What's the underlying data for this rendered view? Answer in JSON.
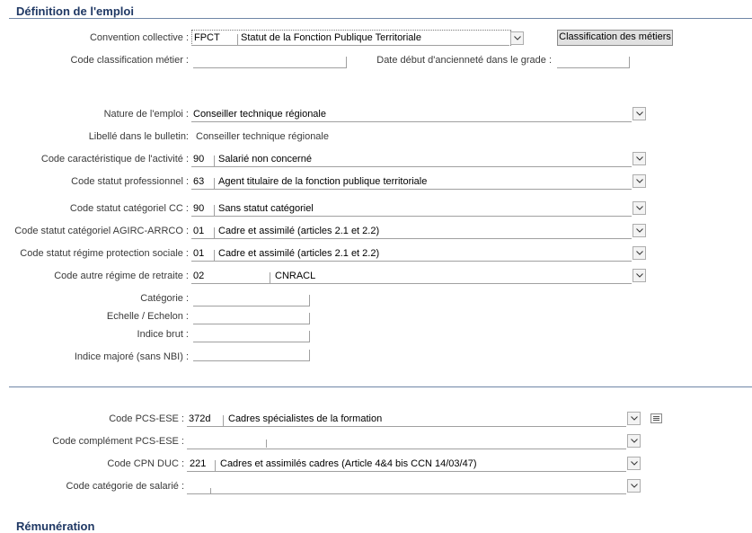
{
  "section": {
    "title": "Définition de l'emploi",
    "next_title": "Rémunération"
  },
  "convention": {
    "label": "Convention collective :",
    "code": "FPCT",
    "value": "Statut de la Fonction Publique Territoriale",
    "button": "Classification des métiers"
  },
  "classification": {
    "label": "Code classification métier :",
    "value": "",
    "date_label": "Date début d'ancienneté dans le grade :",
    "date_value": ""
  },
  "fields": {
    "nature": {
      "label": "Nature de l'emploi :",
      "value": "Conseiller technique régionale"
    },
    "libelle": {
      "label": "Libellé dans le bulletin:",
      "value": "Conseiller technique régionale"
    },
    "activite": {
      "label": "Code caractéristique de l'activité :",
      "code": "90",
      "value": "Salarié non concerné"
    },
    "statut_pro": {
      "label": "Code statut professionnel :",
      "code": "63",
      "value": "Agent titulaire de la fonction publique territoriale"
    },
    "statut_cc": {
      "label": "Code statut catégoriel CC :",
      "code": "90",
      "value": "Sans statut catégoriel"
    },
    "statut_agirc": {
      "label": "Code statut catégoriel AGIRC-ARRCO :",
      "code": "01",
      "value": "Cadre et assimilé (articles 2.1 et 2.2)"
    },
    "regime_protection": {
      "label": "Code statut régime protection sociale :",
      "code": "01",
      "value": "Cadre et assimilé (articles 2.1 et 2.2)"
    },
    "autre_regime": {
      "label": "Code autre régime de retraite :",
      "code": "02",
      "value": "CNRACL"
    },
    "categorie": {
      "label": "Catégorie :",
      "value": ""
    },
    "echelle": {
      "label": "Echelle / Echelon :",
      "value": ""
    },
    "indice_brut": {
      "label": "Indice brut :",
      "value": ""
    },
    "indice_majore": {
      "label": "Indice majoré (sans NBI) :",
      "value": ""
    }
  },
  "pcs": {
    "pcs_ese": {
      "label": "Code PCS-ESE :",
      "code": "372d",
      "value": "Cadres spécialistes de la formation"
    },
    "complement": {
      "label": "Code complément PCS-ESE :",
      "code": "",
      "value": ""
    },
    "cpn_duc": {
      "label": "Code CPN DUC :",
      "code": "221",
      "value": "Cadres et assimilés cadres (Article 4&4 bis CCN 14/03/47)"
    },
    "categorie_salarie": {
      "label": "Code catégorie de salarié :",
      "code": "",
      "value": ""
    }
  },
  "colors": {
    "title": "#1f3864",
    "divider": "#6f86a6",
    "label": "#3a3a3a"
  }
}
